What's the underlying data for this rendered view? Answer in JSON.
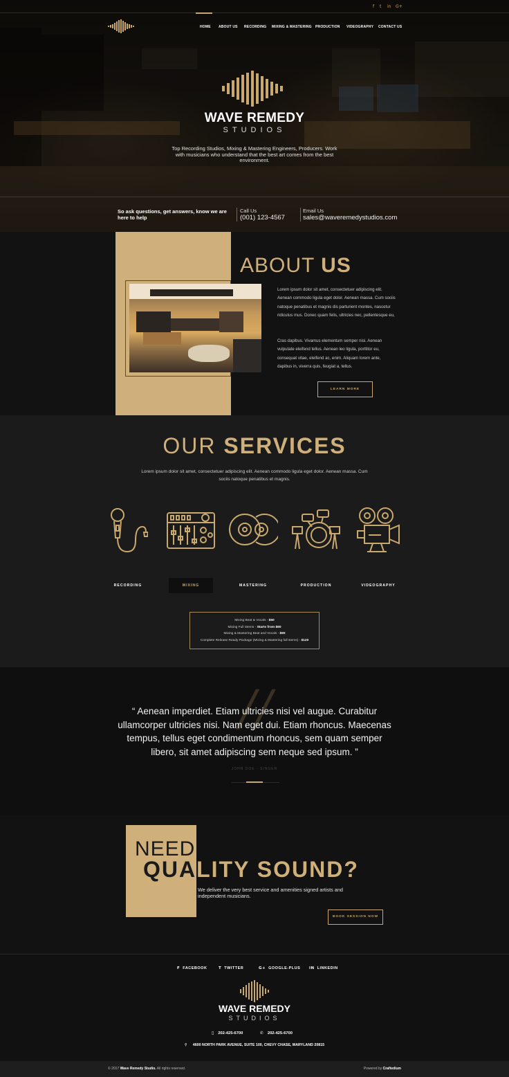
{
  "colors": {
    "accent": "#c9a96e",
    "gold_block": "#d0b07a",
    "bg_dark": "#121212"
  },
  "social_top": [
    "f",
    "t",
    "in",
    "G+"
  ],
  "nav": {
    "items": [
      "Home",
      "About Us",
      "Recording",
      "Mixing & Mastering",
      "Production",
      "Videography",
      "Contact Us"
    ],
    "active": "Home"
  },
  "hero": {
    "title": "WAVE REMEDY",
    "subtitle": "STUDIOS",
    "tagline": "Top Recording Studios, Mixing & Mastering Engineers, Producers. Work with musicians who understand that the best art comes from the best environment."
  },
  "contact_strip": {
    "ask": "So ask questions, get answers, know we are here to help",
    "call_label": "Call Us",
    "call_value": "(001) 123-4567",
    "email_label": "Email Us",
    "email_value": "sales@waveremedystudios.com"
  },
  "about": {
    "title_light": "ABOUT",
    "title_bold": "US",
    "para1": "Lorem ipsum dolor sit amet, consectetuer adipiscing elit. Aenean commodo ligula eget dolor. Aenean massa. Cum sociis natoque penatibus et magnis dis parturient montes, nascetur ridiculus mus. Donec quam felis, ultricies nec, pellentesque eu,",
    "para2": "Cras dapibus. Vivamus elementum semper nisi. Aenean vulputate eleifend tellus. Aenean leo ligula, porttitor eu, consequat vitae, eleifend ac, enim. Aliquam lorem ante, dapibus in, viverra quis, feugiat a, tellus.",
    "button": "LEARN MORE"
  },
  "services": {
    "title_light": "OUR",
    "title_bold": "SERVICES",
    "desc": "Lorem ipsum dolor sit amet, consectetuer adipiscing elit. Aenean commodo ligula eget dolor. Aenean massa. Cum sociis natoque penatibus et magnis.",
    "icons": [
      "microphone-icon",
      "mixer-icon",
      "discs-icon",
      "drums-icon",
      "video-camera-icon"
    ],
    "tabs": [
      "RECORDING",
      "MIXING",
      "MASTERING",
      "PRODUCTION",
      "VIDEOGRAPHY"
    ],
    "active_tab": "MIXING",
    "prices": [
      {
        "label": "Mixing Beat & Vocals - ",
        "price": "$50"
      },
      {
        "label": "Mixing Full Stems - ",
        "price": "Starts from $80"
      },
      {
        "label": "Mixing & Mastering Beat and Vocals - ",
        "price": "$90"
      },
      {
        "label": "Complete Release Ready Package (Mixing & Mastering full stems) - ",
        "price": "$120"
      }
    ]
  },
  "testimonial": {
    "quote": "“ Aenean imperdiet. Etiam ultricies nisi vel augue. Curabitur ullamcorper ultricies nisi. Nam eget dui. Etiam rhoncus. Maecenas tempus, tellus eget condimentum rhoncus, sem quam semper libero, sit amet adipiscing sem neque sed ipsum. ”",
    "author": "JOHN DOE - SINGER"
  },
  "cta": {
    "need": "NEED",
    "quality_dark": "QUA",
    "quality_gold": "LITY SOUND?",
    "desc": "We deliver the very best service and amenities signed artists and independent musicians.",
    "button": "BOOK SESSION NOW"
  },
  "footer": {
    "social": [
      {
        "icon": "f",
        "label": "FACEBOOK"
      },
      {
        "icon": "t",
        "label": "TWITTER"
      },
      {
        "icon": "G+",
        "label": "GOOGLE-PLUS"
      },
      {
        "icon": "in",
        "label": "LINKEDIN"
      }
    ],
    "title": "WAVE REMEDY",
    "subtitle": "STUDIOS",
    "phone1": "202-425-6700",
    "phone2": "202-425-6700",
    "address": "4600 NORTH PARK AVENUE, SUITE 100, CHEVY CHASE, MARYLAND 20815",
    "copyright_prefix": "© 2017 ",
    "copyright_brand": "Wave Remedy Studio.",
    "copyright_suffix": " All rights reserved.",
    "powered_prefix": "Powered by ",
    "powered_brand": "Craftedium"
  }
}
